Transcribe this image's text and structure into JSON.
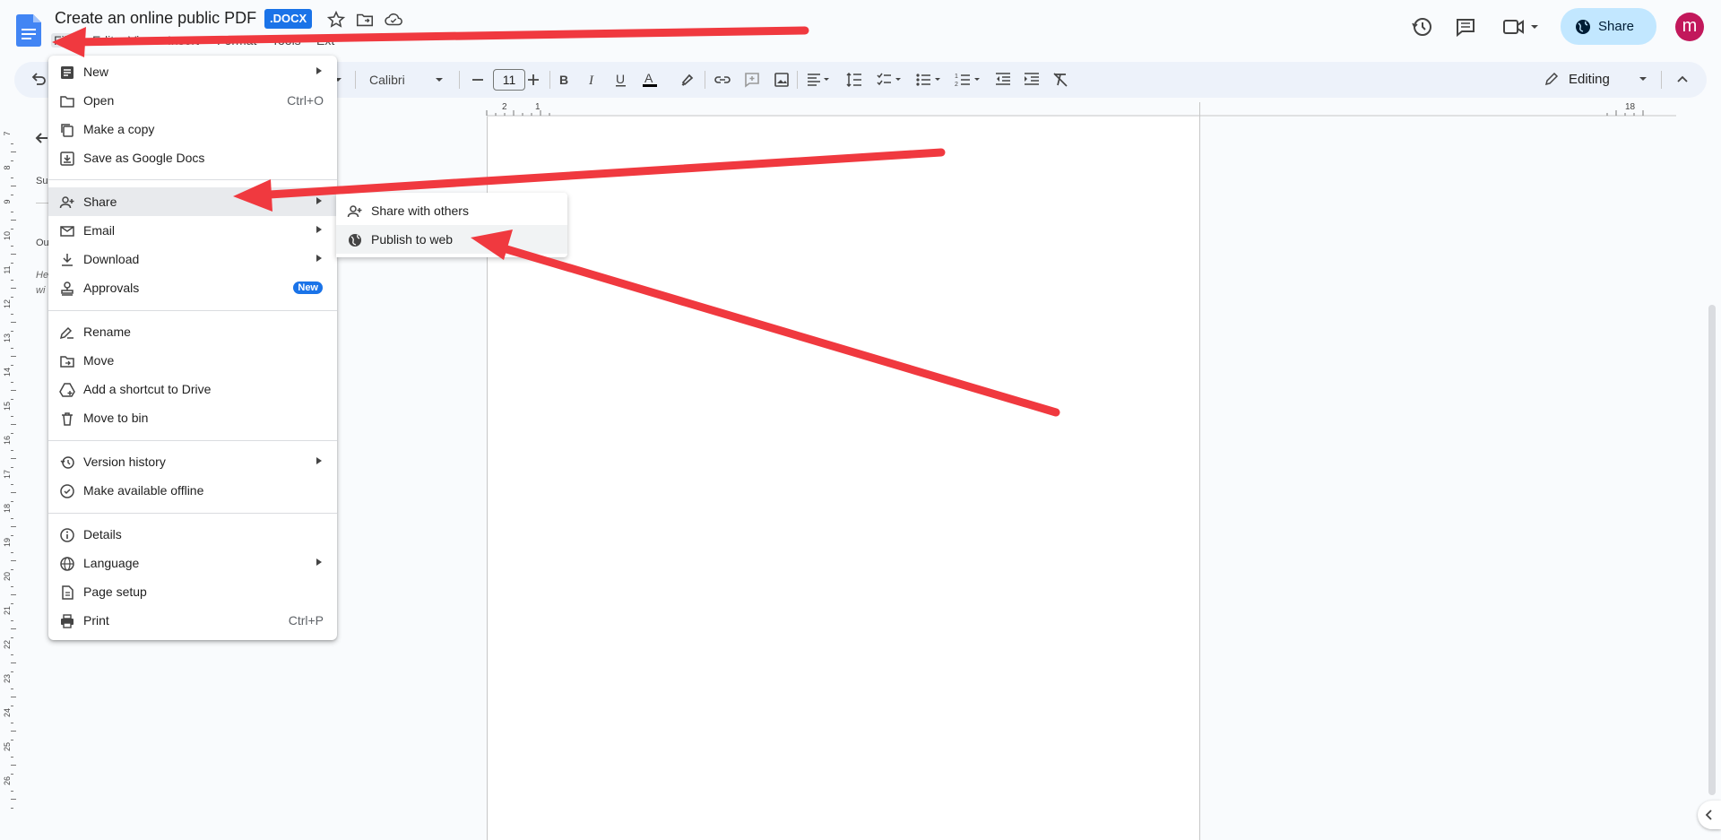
{
  "header": {
    "title": "Create an online public PDF",
    "badge": ".DOCX",
    "share_label": "Share",
    "avatar_letter": "m"
  },
  "menubar": [
    "File",
    "Edit",
    "View",
    "Insert",
    "Format",
    "Tools",
    "Ext"
  ],
  "toolbar": {
    "font_family": "Calibri",
    "font_size": "11",
    "mode": "Editing"
  },
  "ruler": {
    "h_labels": [
      "2",
      "1",
      "18"
    ],
    "v_labels": [
      "7",
      "8",
      "9",
      "10",
      "11",
      "12",
      "13",
      "14",
      "15",
      "16",
      "17",
      "18",
      "19",
      "20",
      "21",
      "22",
      "23",
      "24",
      "25",
      "26"
    ]
  },
  "outline": {
    "su": "Su",
    "ou": "Ou",
    "he": "He",
    "wi": "wi"
  },
  "file_menu": {
    "items": [
      {
        "label": "New",
        "icon": "document-icon",
        "submenu": true
      },
      {
        "label": "Open",
        "icon": "folder-icon",
        "shortcut": "Ctrl+O"
      },
      {
        "label": "Make a copy",
        "icon": "copy-icon"
      },
      {
        "label": "Save as Google Docs",
        "icon": "save-icon"
      },
      {
        "label": "Share",
        "icon": "person-add-icon",
        "submenu": true
      },
      {
        "label": "Email",
        "icon": "mail-icon",
        "submenu": true
      },
      {
        "label": "Download",
        "icon": "download-icon",
        "submenu": true
      },
      {
        "label": "Approvals",
        "icon": "approval-icon",
        "badge": "New"
      },
      {
        "label": "Rename",
        "icon": "rename-icon"
      },
      {
        "label": "Move",
        "icon": "move-folder-icon"
      },
      {
        "label": "Add a shortcut to Drive",
        "icon": "drive-shortcut-icon"
      },
      {
        "label": "Move to bin",
        "icon": "trash-icon"
      },
      {
        "label": "Version history",
        "icon": "history-icon",
        "submenu": true
      },
      {
        "label": "Make available offline",
        "icon": "offline-icon"
      },
      {
        "label": "Details",
        "icon": "info-icon"
      },
      {
        "label": "Language",
        "icon": "globe-icon",
        "submenu": true
      },
      {
        "label": "Page setup",
        "icon": "page-setup-icon"
      },
      {
        "label": "Print",
        "icon": "printer-icon",
        "shortcut": "Ctrl+P"
      }
    ]
  },
  "share_submenu": {
    "items": [
      {
        "label": "Share with others",
        "icon": "person-add-icon"
      },
      {
        "label": "Publish to web",
        "icon": "globe-icon"
      }
    ]
  },
  "colors": {
    "accent": "#1a73e8",
    "annotation_arrow": "#f0393f",
    "share_button": "#c2e7ff",
    "avatar": "#c2185b"
  }
}
